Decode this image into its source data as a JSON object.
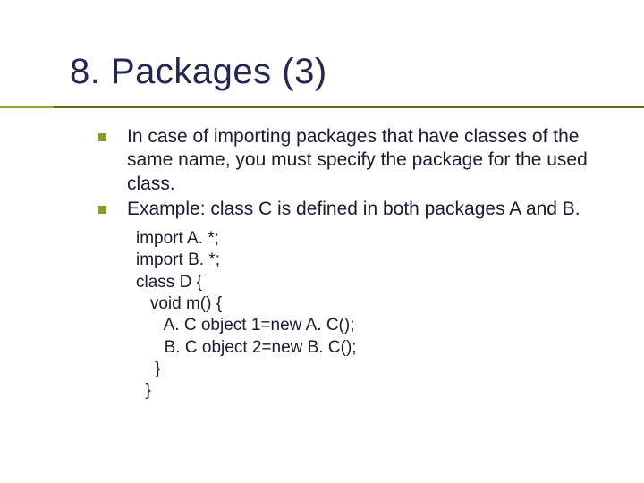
{
  "title": "8. Packages (3)",
  "bullets": [
    "In case of importing packages that have classes of the same name, you must specify the package for the used class.",
    "Example: class C is defined in both packages A and B."
  ],
  "code": "import A. *;\nimport B. *;\nclass D {\n   void m() {\n      A. C object 1=new A. C();\n      B. C object 2=new B. C();\n    }\n  }"
}
